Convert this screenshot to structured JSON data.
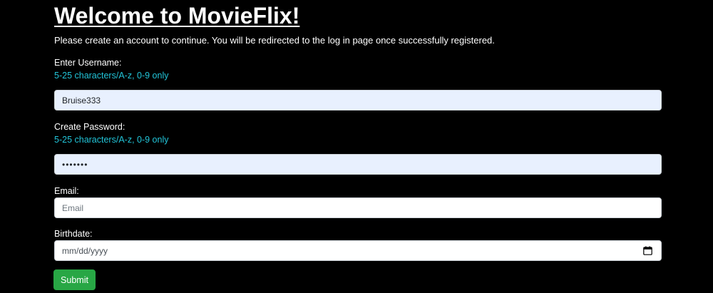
{
  "page": {
    "title": "Welcome to MovieFlix!",
    "subtitle": "Please create an account to continue. You will be redirected to the log in page once successfully registered."
  },
  "form": {
    "username": {
      "label": "Enter Username:",
      "hint": "5-25 characters/A-z, 0-9 only",
      "value": "Bruise333"
    },
    "password": {
      "label": "Create Password:",
      "hint": "5-25 characters/A-z, 0-9 only",
      "masked_value": "•••••••"
    },
    "email": {
      "label": "Email:",
      "placeholder": "Email"
    },
    "birthdate": {
      "label": "Birthdate:",
      "placeholder": "mm/dd/yyyy",
      "icon": "calendar-icon"
    },
    "submit_label": "Submit"
  },
  "colors": {
    "background": "#000000",
    "hint": "#22c4d8",
    "autofill_bg": "#e8f0fe",
    "submit_bg": "#28a745"
  }
}
